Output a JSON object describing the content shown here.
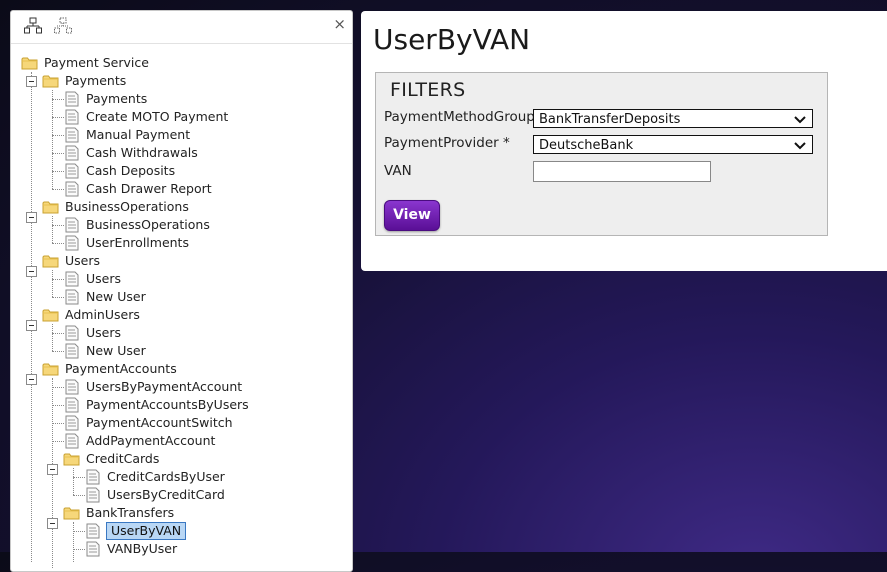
{
  "tree": {
    "root": "Payment Service",
    "groups": {
      "payments": {
        "label": "Payments",
        "items": [
          "Payments",
          "Create MOTO Payment",
          "Manual Payment",
          "Cash Withdrawals",
          "Cash Deposits",
          "Cash Drawer Report"
        ]
      },
      "business": {
        "label": "BusinessOperations",
        "items": [
          "BusinessOperations",
          "UserEnrollments"
        ]
      },
      "users": {
        "label": "Users",
        "items": [
          "Users",
          "New User"
        ]
      },
      "admin": {
        "label": "AdminUsers",
        "items": [
          "Users",
          "New User"
        ]
      },
      "paymentAccounts": {
        "label": "PaymentAccounts",
        "items": [
          "UsersByPaymentAccount",
          "PaymentAccountsByUsers",
          "PaymentAccountSwitch",
          "AddPaymentAccount"
        ],
        "creditCards": {
          "label": "CreditCards",
          "items": [
            "CreditCardsByUser",
            "UsersByCreditCard"
          ]
        },
        "bankTransfers": {
          "label": "BankTransfers",
          "items": [
            "UserByVAN",
            "VANByUser"
          ]
        }
      }
    },
    "close_glyph": "×"
  },
  "report": {
    "title": "UserByVAN",
    "filters": {
      "heading": "FILTERS",
      "method_group_label": "PaymentMethodGroup",
      "method_group_value": "BankTransferDeposits",
      "provider_label": "PaymentProvider  *",
      "provider_value": "DeutscheBank",
      "van_label": "VAN",
      "van_value": ""
    },
    "view_button": "View"
  },
  "icons": {
    "chevron": "⌄",
    "toolbar": [
      "expand-all-icon",
      "collapse-all-icon"
    ]
  },
  "colors": {
    "accent": "#6a1fb0",
    "selection": "#b9d7f5"
  }
}
